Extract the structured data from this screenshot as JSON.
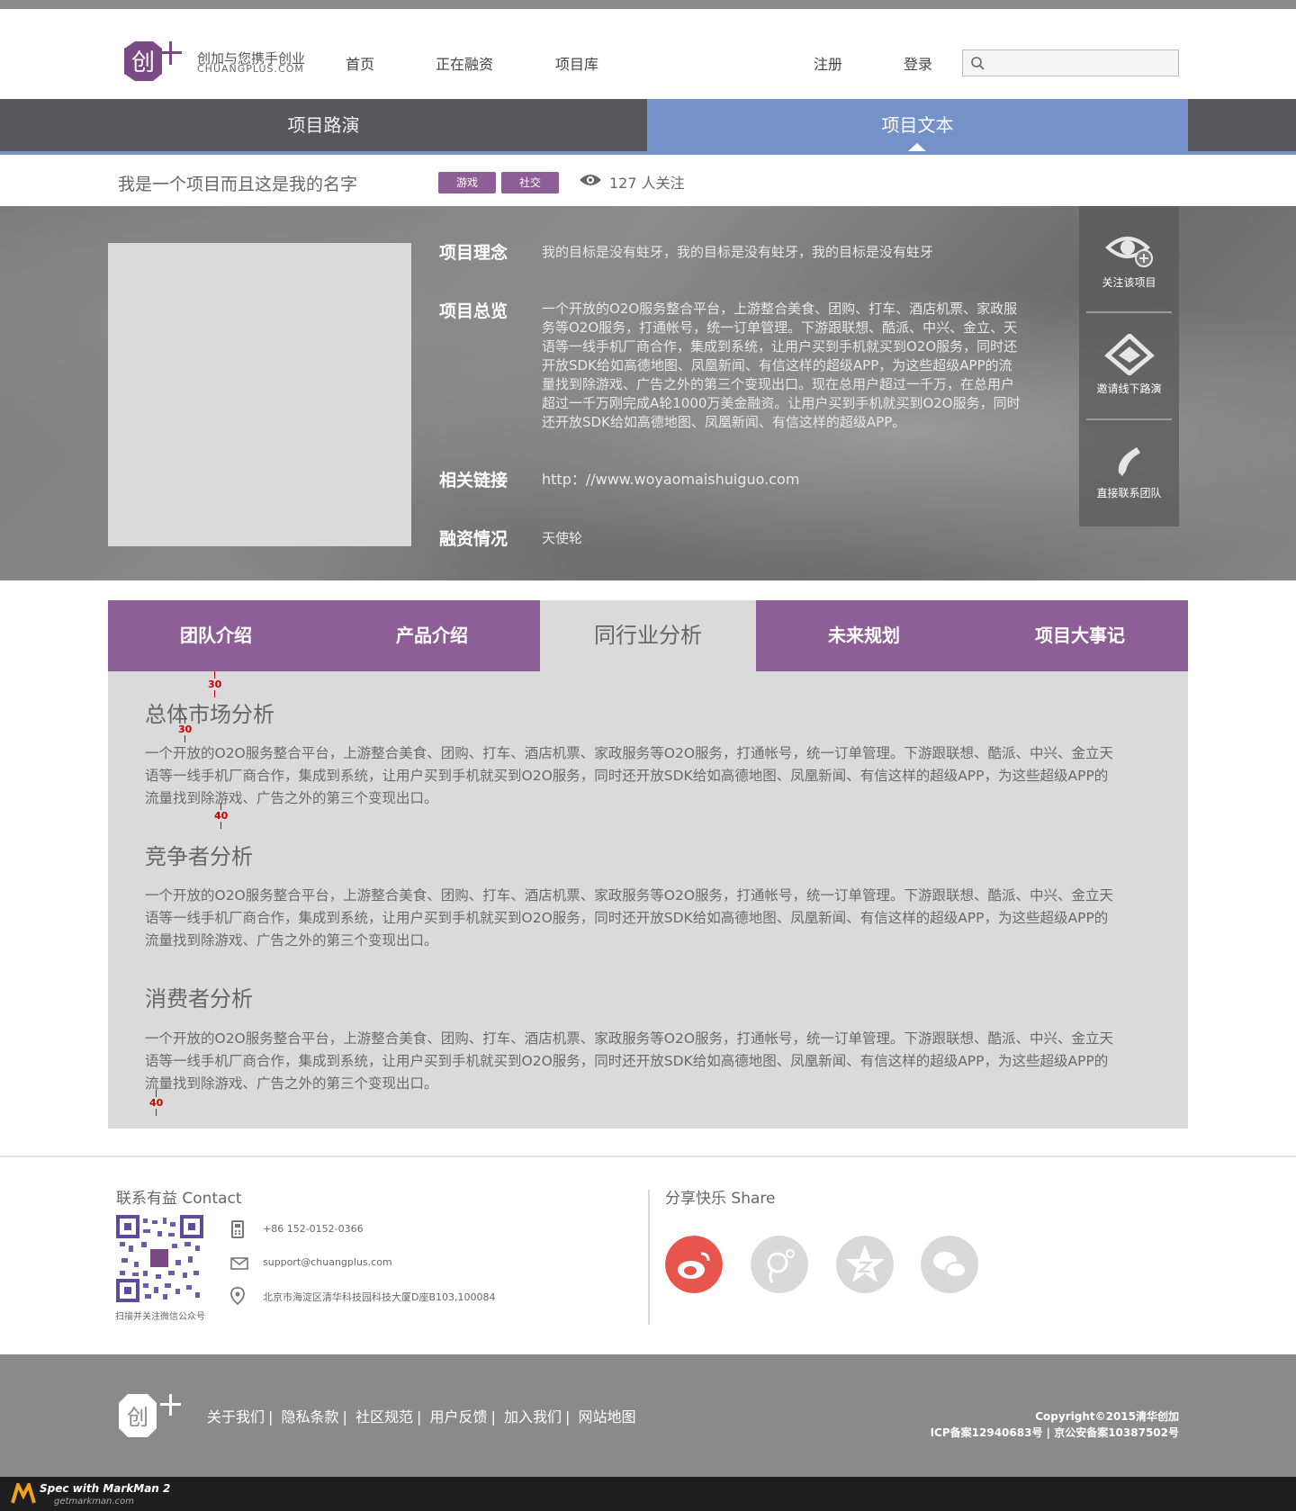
{
  "header": {
    "logo_cn": "创加与您携手创业",
    "logo_en": "CHUANGPLUS.COM",
    "nav": [
      "首页",
      "正在融资",
      "项目库"
    ],
    "register": "注册",
    "login": "登录",
    "search_placeholder": ""
  },
  "top_tabs": {
    "roadshow": "项目路演",
    "text": "项目文本"
  },
  "project": {
    "name": "我是一个项目而且这是我的名字",
    "tags": [
      "游戏",
      "社交"
    ],
    "followers": "127 人关注"
  },
  "hero": {
    "concept_label": "项目理念",
    "concept": "我的目标是没有蛀牙，我的目标是没有蛀牙，我的目标是没有蛀牙",
    "overview_label": "项目总览",
    "overview_lines": [
      "一个开放的O2O服务整合平台，上游整合美食、团购、打车、酒店机票、家政服",
      "务等O2O服务，打通帐号，统一订单管理。下游跟联想、酷派、中兴、金立、天",
      "语等一线手机厂商合作，集成到系统，让用户买到手机就买到O2O服务，同时还",
      "开放SDK给如高德地图、凤凰新闻、有信这样的超级APP，为这些超级APP的流",
      "量找到除游戏、广告之外的第三个变现出口。现在总用户超过一千万，在总用户",
      "超过一千万刚完成A轮1000万美金融资。让用户买到手机就买到O2O服务，同时",
      "还开放SDK给如高德地图、凤凰新闻、有信这样的超级APP。"
    ],
    "link_label": "相关链接",
    "link": "http：//www.woyaomaishuiguo.com",
    "funding_label": "融资情况",
    "funding": "天使轮"
  },
  "side_actions": [
    "关注该项目",
    "邀请线下路演",
    "直接联系团队"
  ],
  "content_tabs": [
    "团队介绍",
    "产品介绍",
    "同行业分析",
    "未来规划",
    "项目大事记"
  ],
  "sections": [
    {
      "title": "总体市场分析",
      "lines": [
        "一个开放的O2O服务整合平台，上游整合美食、团购、打车、酒店机票、家政服务等O2O服务，打通帐号，统一订单管理。下游跟联想、酷派、中兴、金立天",
        "语等一线手机厂商合作，集成到系统，让用户买到手机就买到O2O服务，同时还开放SDK给如高德地图、凤凰新闻、有信这样的超级APP，为这些超级APP的",
        "流量找到除游戏、广告之外的第三个变现出口。"
      ]
    },
    {
      "title": "竞争者分析",
      "lines": [
        "一个开放的O2O服务整合平台，上游整合美食、团购、打车、酒店机票、家政服务等O2O服务，打通帐号，统一订单管理。下游跟联想、酷派、中兴、金立天",
        "语等一线手机厂商合作，集成到系统，让用户买到手机就买到O2O服务，同时还开放SDK给如高德地图、凤凰新闻、有信这样的超级APP，为这些超级APP的",
        "流量找到除游戏、广告之外的第三个变现出口。"
      ]
    },
    {
      "title": "消费者分析",
      "lines": [
        "一个开放的O2O服务整合平台，上游整合美食、团购、打车、酒店机票、家政服务等O2O服务，打通帐号，统一订单管理。下游跟联想、酷派、中兴、金立天",
        "语等一线手机厂商合作，集成到系统，让用户买到手机就买到O2O服务，同时还开放SDK给如高德地图、凤凰新闻、有信这样的超级APP，为这些超级APP的",
        "流量找到除游戏、广告之外的第三个变现出口。"
      ]
    }
  ],
  "spec_marks": [
    "30",
    "30",
    "40",
    "40"
  ],
  "contact": {
    "title": "联系有益 Contact",
    "qr_caption": "扫描并关注微信公众号",
    "phone": "+86 152-0152-0366",
    "email": "support@chuangplus.com",
    "address": "北京市海淀区清华科技园科技大厦D座B103,100084"
  },
  "share": {
    "title": "分享快乐 Share",
    "icons": [
      "weibo-icon",
      "tencent-weibo-icon",
      "qzone-icon",
      "wechat-icon"
    ]
  },
  "footer": {
    "links": [
      "关于我们",
      "隐私条款",
      "社区规范",
      "用户反馈",
      "加入我们",
      "网站地图"
    ],
    "copyright": "Copyright©2015清华创加",
    "icp": "ICP备案12940683号 | 京公安备案10387502号"
  },
  "markman": {
    "title": "Spec with MarkMan 2",
    "url": "getmarkman.com"
  },
  "colors": {
    "purple": "#8e5f96",
    "blue": "#7492c7",
    "weibo_red": "#e8554d"
  }
}
